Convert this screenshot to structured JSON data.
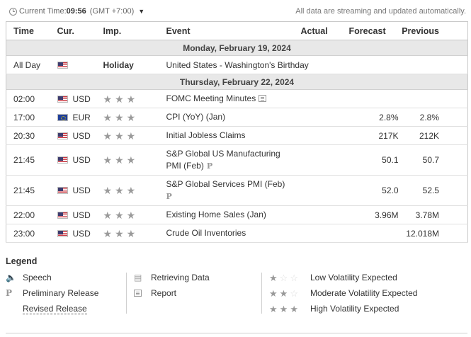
{
  "topbar": {
    "current_time_label": "Current Time:",
    "current_time": "09:56",
    "timezone": "(GMT +7:00)",
    "streaming_note": "All data are streaming and updated automatically."
  },
  "columns": {
    "time": "Time",
    "currency": "Cur.",
    "importance": "Imp.",
    "event": "Event",
    "actual": "Actual",
    "forecast": "Forecast",
    "previous": "Previous"
  },
  "days": [
    {
      "date": "Monday, February 19, 2024",
      "events": [
        {
          "time": "All Day",
          "flag": "us",
          "currency": "",
          "holiday_label": "Holiday",
          "event": "United States - Washington's Birthday"
        }
      ]
    },
    {
      "date": "Thursday, February 22, 2024",
      "events": [
        {
          "time": "02:00",
          "flag": "us",
          "currency": "USD",
          "stars": 3,
          "event": "FOMC Meeting Minutes",
          "icon": "report-icon",
          "actual": "",
          "forecast": "",
          "previous": ""
        },
        {
          "time": "17:00",
          "flag": "eu",
          "currency": "EUR",
          "stars": 3,
          "event": "CPI (YoY) (Jan)",
          "actual": "",
          "forecast": "2.8%",
          "previous": "2.8%",
          "previous_color": "#d91e18"
        },
        {
          "time": "20:30",
          "flag": "us",
          "currency": "USD",
          "stars": 3,
          "event": "Initial Jobless Claims",
          "actual": "",
          "forecast": "217K",
          "previous": "212K"
        },
        {
          "time": "21:45",
          "flag": "us",
          "currency": "USD",
          "stars": 3,
          "event": "S&P Global US Manufacturing PMI (Feb)",
          "event_line1": "S&P Global US Manufacturing",
          "event_line2": "PMI (Feb)",
          "icon": "preliminary-icon",
          "actual": "",
          "forecast": "50.1",
          "previous": "50.7"
        },
        {
          "time": "21:45",
          "flag": "us",
          "currency": "USD",
          "stars": 3,
          "event": "S&P Global Services PMI (Feb)",
          "icon": "preliminary-icon",
          "actual": "",
          "forecast": "52.0",
          "previous": "52.5"
        },
        {
          "time": "22:00",
          "flag": "us",
          "currency": "USD",
          "stars": 3,
          "event": "Existing Home Sales (Jan)",
          "actual": "",
          "forecast": "3.96M",
          "previous": "3.78M"
        },
        {
          "time": "23:00",
          "flag": "us",
          "currency": "USD",
          "stars": 3,
          "event": "Crude Oil Inventories",
          "actual": "",
          "forecast": "",
          "previous": "12.018M"
        }
      ]
    }
  ],
  "prelim_glyph": "P",
  "legend": {
    "title": "Legend",
    "speech": "Speech",
    "preliminary": "Preliminary Release",
    "revised": "Revised Release",
    "retrieving": "Retrieving Data",
    "report": "Report",
    "low": "Low Volatility Expected",
    "moderate": "Moderate Volatility Expected",
    "high": "High Volatility Expected"
  },
  "colors": {
    "negative": "#d91e18",
    "day_header_bg": "#e8e8e8"
  }
}
